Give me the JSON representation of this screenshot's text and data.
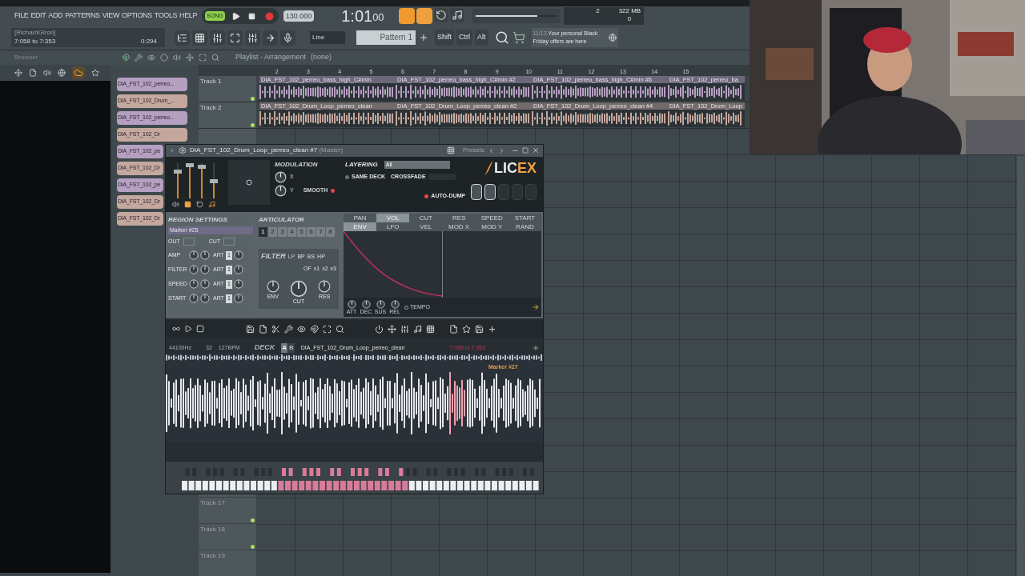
{
  "menu": [
    "FILE",
    "EDIT",
    "ADD",
    "PATTERNS",
    "VIEW",
    "OPTIONS",
    "TOOLS",
    "HELP"
  ],
  "transport": {
    "mode": "SONG",
    "tempo": "130.000",
    "time": "1:01",
    "time_sub": "00"
  },
  "hint": {
    "user": "[RichardGiron]",
    "range": "7:058 to 7:353",
    "value": "0:294"
  },
  "snap": "Line",
  "pattern": "Pattern 1",
  "modifier_keys": [
    "Shift",
    "Ctrl",
    "Alt"
  ],
  "monitor": {
    "cpu": "2",
    "memory": "322 MB",
    "polyphony": "0",
    "level": 0.75
  },
  "news": {
    "date": "11/13",
    "lines": [
      "Your personal Black",
      "Friday offers are here"
    ]
  },
  "browser": {
    "title": "Browser"
  },
  "playlist": {
    "title": "Playlist - Arrangement",
    "pattern": "(none)",
    "bars": [
      "2",
      "3",
      "4",
      "5",
      "6",
      "7",
      "8",
      "9",
      "10",
      "11",
      "12",
      "13",
      "14",
      "15"
    ]
  },
  "picker": [
    {
      "label": "DIA_FST_102_perreo...",
      "color": "#b6a0c2"
    },
    {
      "label": "DIA_FST_102_Drum_...",
      "color": "#c4a89e"
    },
    {
      "label": "DIA_FST_102_perreo...",
      "color": "#b6a0c2"
    },
    {
      "label": "DIA_FST_102_Dr",
      "color": "#c4a89e"
    },
    {
      "label": "DIA_FST_102_pe",
      "color": "#b6a0c2"
    },
    {
      "label": "DIA_FST_102_Dr",
      "color": "#c4a89e"
    },
    {
      "label": "DIA_FST_102_pe",
      "color": "#b6a0c2"
    },
    {
      "label": "DIA_FST_102_Dr",
      "color": "#c4a89e"
    },
    {
      "label": "DIA_FST_102_Dr",
      "color": "#c4a89e"
    }
  ],
  "tracks_top": [
    {
      "name": "Track 1",
      "color": "#b6a0c2",
      "clips": [
        "DIA_FST_102_perreo_bass_high_C#min",
        "DIA_FST_102_perreo_bass_high_C#min #2",
        "DIA_FST_102_perreo_bass_high_C#min #6",
        "DIA_FST_102_perreo_ba"
      ]
    },
    {
      "name": "Track 2",
      "color": "#c4a89e",
      "clips": [
        "DIA_FST_102_Drum_Loop_perreo_clean",
        "DIA_FST_102_Drum_Loop_perreo_clean #2",
        "DIA_FST_102_Drum_Loop_perreo_clean #4",
        "DIA_FST_102_Drum_Loop"
      ]
    }
  ],
  "tracks_bottom": [
    {
      "name": "Track 17"
    },
    {
      "name": "Track 18"
    },
    {
      "name": "Track 19"
    }
  ],
  "slicex": {
    "title": "DIA_FST_102_Drum_Loop_perreo_clean #7",
    "route": "(Master)",
    "presets": "Presets",
    "modulation": {
      "label": "MODULATION",
      "knobs": [
        "X",
        "Y"
      ],
      "smooth": "SMOOTH"
    },
    "layering": {
      "label": "LAYERING",
      "value": "All",
      "same_deck": "SAME DECK",
      "crossfade": "CROSSFADE",
      "auto_dump": "AUTO-DUMP"
    },
    "logo": [
      "LIC",
      "EX"
    ],
    "region": {
      "title": "REGION SETTINGS",
      "marker": "Marker #25",
      "out": "OUT",
      "cut": "CUT",
      "rows": [
        {
          "label": "AMP",
          "art": "ART",
          "value": "1"
        },
        {
          "label": "FILTER",
          "art": "ART",
          "value": "1"
        },
        {
          "label": "SPEED",
          "art": "ART",
          "value": "1"
        },
        {
          "label": "START",
          "art": "ART",
          "value": "1"
        }
      ]
    },
    "articulator": {
      "title": "ARTICULATOR",
      "slots": [
        {
          "label": "1",
          "selected": true
        },
        {
          "label": "2",
          "selected": false
        },
        {
          "label": "3",
          "selected": false
        },
        {
          "label": "4",
          "selected": false
        },
        {
          "label": "5",
          "selected": false
        },
        {
          "label": "6",
          "selected": false
        },
        {
          "label": "7",
          "selected": false
        },
        {
          "label": "8",
          "selected": false
        }
      ]
    },
    "filter": {
      "title": "FILTER",
      "types": [
        "LP",
        "BP",
        "BS",
        "HP"
      ],
      "order_label": "OF",
      "orders": [
        "x1",
        "x2",
        "x3"
      ],
      "knobs": [
        "ENV",
        "CUT",
        "RES"
      ]
    },
    "env_tabs": [
      [
        {
          "label": "PAN",
          "selected": false
        },
        {
          "label": "VOL",
          "selected": true
        },
        {
          "label": "CUT",
          "selected": false
        },
        {
          "label": "RES",
          "selected": false
        },
        {
          "label": "SPEED",
          "selected": false
        },
        {
          "label": "START",
          "selected": false
        }
      ],
      [
        {
          "label": "ENV",
          "selected": true
        },
        {
          "label": "LFO",
          "selected": false
        },
        {
          "label": "VEL",
          "selected": false
        },
        {
          "label": "MOD X",
          "selected": false
        },
        {
          "label": "MOD Y",
          "selected": false
        },
        {
          "label": "RAND",
          "selected": false
        }
      ]
    ],
    "env_knobs": [
      "ATT",
      "DEC",
      "SUS",
      "REL"
    ],
    "tempo": "TEMPO",
    "info": {
      "samplerate": "44100Hz",
      "format": "32",
      "tempo": "127BPM",
      "deck_label": "DECK",
      "decks": [
        {
          "label": "A",
          "selected": true
        },
        {
          "label": "B",
          "selected": false
        }
      ],
      "name": "DIA_FST_102_Drum_Loop_perreo_clean",
      "length": "7:058 to 7:353"
    },
    "marker": "Marker #27"
  }
}
